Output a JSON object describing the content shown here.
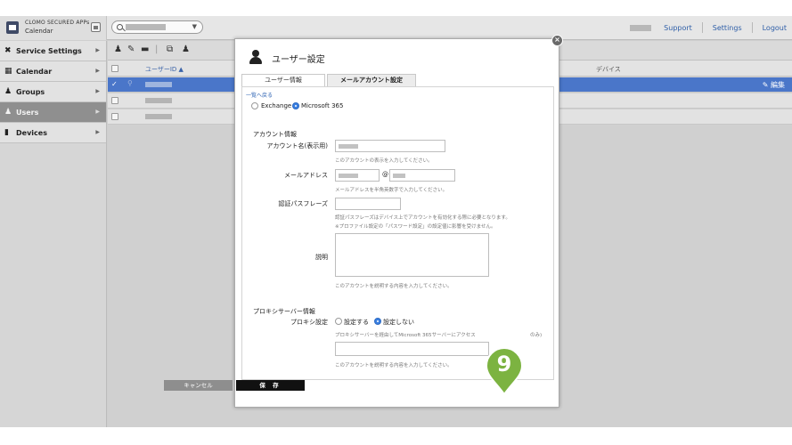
{
  "brand": {
    "top": "CLOMO SECURED APPs",
    "app": "Calendar"
  },
  "topnav": {
    "support": "Support",
    "settings": "Settings",
    "logout": "Logout"
  },
  "sidebar": {
    "items": [
      {
        "label": "Service Settings",
        "icon": "wrench-icon"
      },
      {
        "label": "Calendar",
        "icon": "calendar-icon"
      },
      {
        "label": "Groups",
        "icon": "groups-icon"
      },
      {
        "label": "Users",
        "icon": "user-icon"
      },
      {
        "label": "Devices",
        "icon": "device-icon"
      }
    ]
  },
  "table": {
    "col_userid": "ユーザーID ▲",
    "col_device": "デバイス",
    "edit": "✎ 編集"
  },
  "modal": {
    "title": "ユーザー設定",
    "tabs": [
      "ユーザー情報",
      "メールアカウント設定"
    ],
    "back": "一覧へ戻る",
    "server_exchange": "Exchange",
    "server_m365": "Microsoft 365",
    "account_section": "アカウント情報",
    "account_name_label": "アカウント名(表示用)",
    "account_name_hint": "このアカウントの表示を入力してください。",
    "email_label": "メールアドレス",
    "at": "@",
    "email_hint": "メールアドレスを半角英数字で入力してください。",
    "passphrase_label": "認証パスフレーズ",
    "passphrase_hint1": "認証パスフレーズはデバイス上でアカウントを有効化する際に必要となります。",
    "passphrase_hint2": "※プロファイル設定の「パスワード設定」の設定値に影響を受けません。",
    "desc_label": "説明",
    "desc_hint": "このアカウントを説明する内容を入力してください。",
    "proxy_section": "プロキシサーバー情報",
    "proxy_label": "プロキシ設定",
    "proxy_on": "設定する",
    "proxy_off": "設定しない",
    "proxy_hint": "プロキシサーバーを経由してMicrosoft 365サーバーにアクセス",
    "proxy_hint_tail": "のみ)",
    "proxy_input_hint": "このアカウントを説明する内容を入力してください。",
    "cancel": "キャンセル",
    "save": "保 存"
  },
  "callout": {
    "number": "9",
    "color": "#7cb341"
  }
}
